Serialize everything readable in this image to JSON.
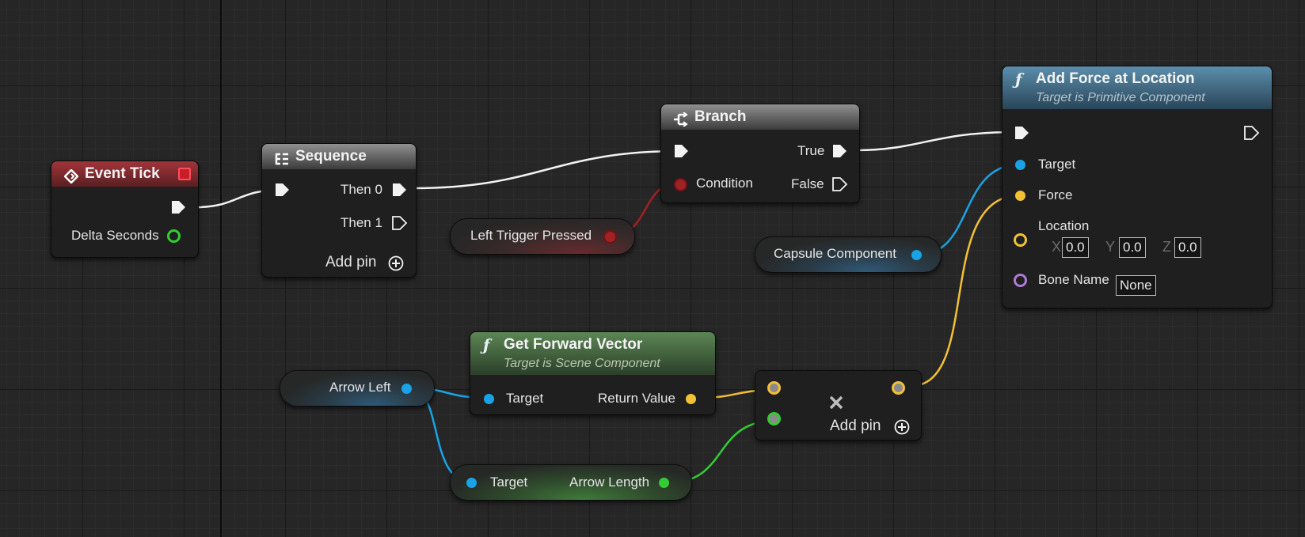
{
  "colors": {
    "exec_wire": "#f2f2f2",
    "bool": "#a32025",
    "object": "#19a3e6",
    "vector": "#f3c134",
    "float": "#33cc33",
    "name": "#b07ad8"
  },
  "nodes": {
    "event_tick": {
      "title": "Event Tick",
      "out_label": "Delta Seconds"
    },
    "sequence": {
      "title": "Sequence",
      "then0": "Then 0",
      "then1": "Then 1",
      "add_pin": "Add pin"
    },
    "branch": {
      "title": "Branch",
      "condition": "Condition",
      "true_label": "True",
      "false_label": "False"
    },
    "left_trigger": {
      "label": "Left Trigger Pressed"
    },
    "add_force": {
      "title": "Add Force at Location",
      "subtitle": "Target is Primitive Component",
      "target": "Target",
      "force": "Force",
      "location": "Location",
      "x_label": "X",
      "y_label": "Y",
      "z_label": "Z",
      "x_value": "0.0",
      "y_value": "0.0",
      "z_value": "0.0",
      "bone_name": "Bone Name",
      "bone_value": "None"
    },
    "capsule": {
      "label": "Capsule Component"
    },
    "get_forward": {
      "title": "Get Forward Vector",
      "subtitle": "Target is Scene Component",
      "target": "Target",
      "return_value": "Return Value"
    },
    "arrow_left": {
      "label": "Arrow Left"
    },
    "multiply": {
      "add_pin": "Add pin"
    },
    "arrow_length": {
      "target": "Target",
      "output": "Arrow Length"
    }
  }
}
